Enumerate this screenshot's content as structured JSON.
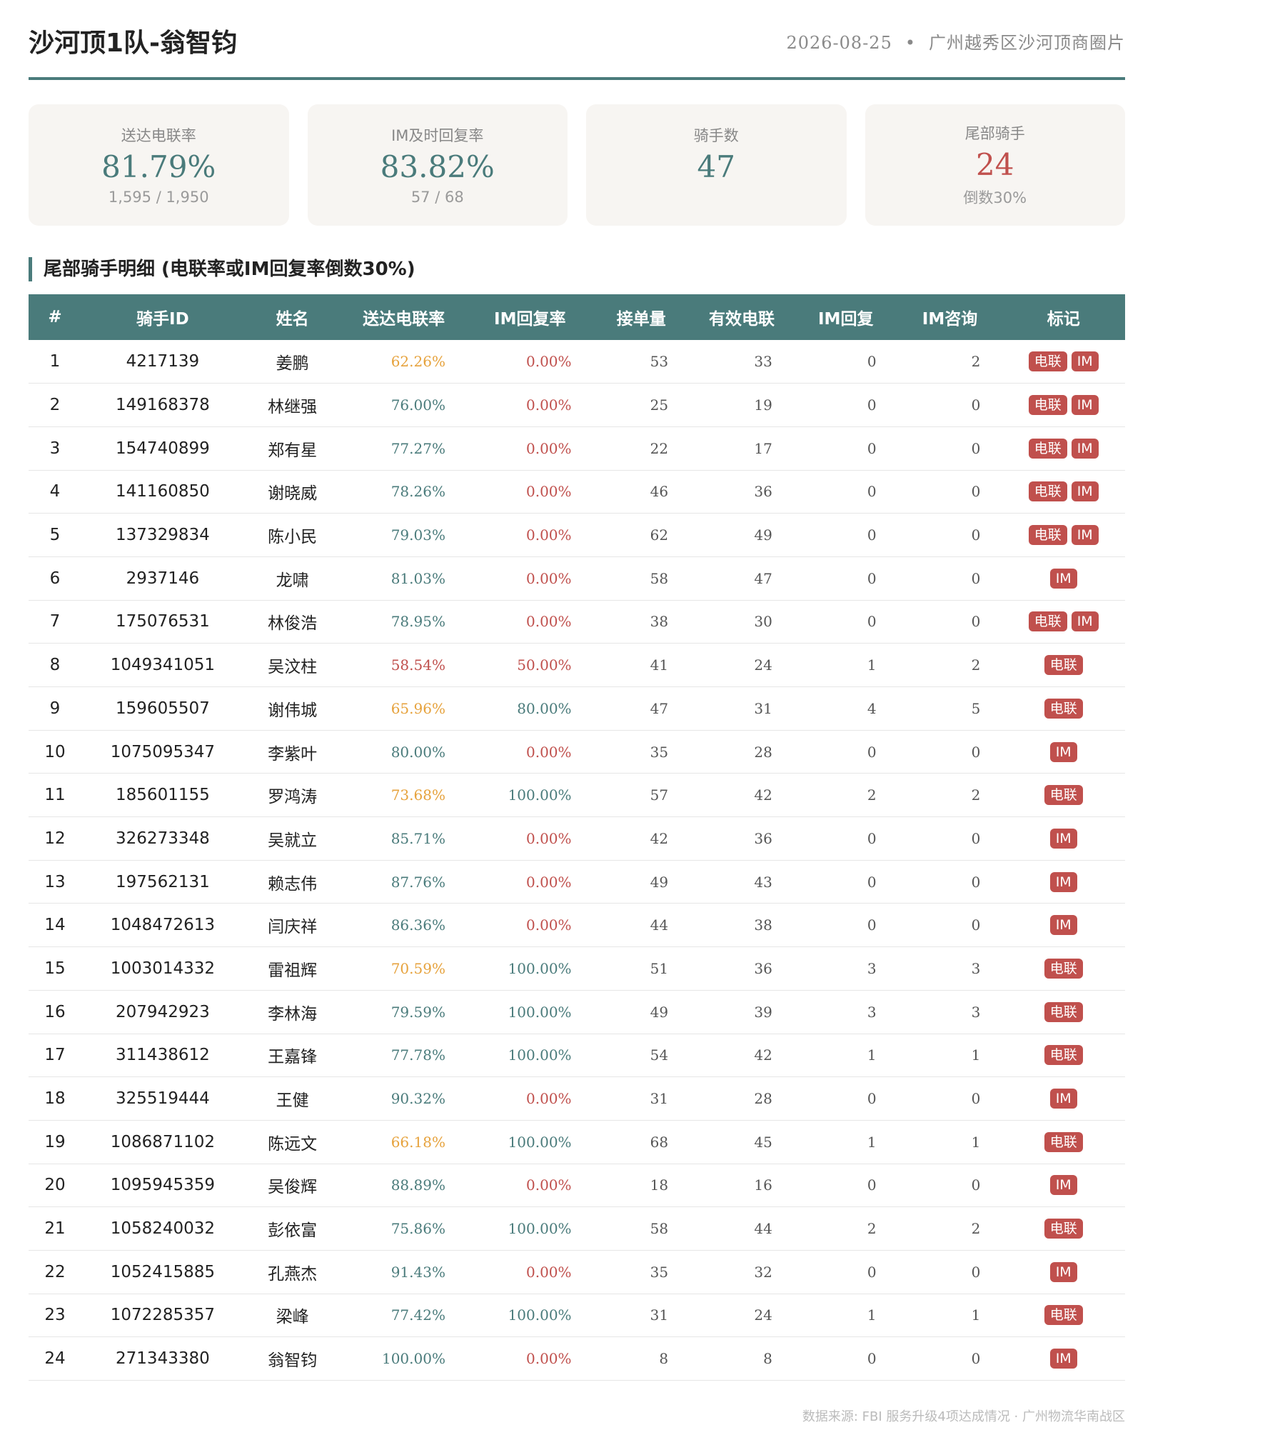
{
  "header": {
    "title": "沙河顶1队-翁智钧",
    "date": "2026-08-25",
    "separator": "•",
    "area": "广州越秀区沙河顶商圈片"
  },
  "cards": [
    {
      "label": "送达电联率",
      "value": "81.79%",
      "sub": "1,595 / 1,950",
      "accent": "#4a7b7b"
    },
    {
      "label": "IM及时回复率",
      "value": "83.82%",
      "sub": "57 / 68",
      "accent": "#4a7b7b"
    },
    {
      "label": "骑手数",
      "value": "47",
      "sub": "",
      "accent": "#4a7b7b"
    },
    {
      "label": "尾部骑手",
      "value": "24",
      "sub": "倒数30%",
      "accent": "#c0504d"
    }
  ],
  "section_title": "尾部骑手明细 (电联率或IM回复率倒数30%)",
  "table": {
    "headers": [
      "#",
      "骑手ID",
      "姓名",
      "送达电联率",
      "IM回复率",
      "接单量",
      "有效电联",
      "IM回复",
      "IM咨询",
      "标记"
    ],
    "rows": [
      {
        "idx": "1",
        "id": "4217139",
        "name": "姜鹏",
        "rate": "62.26%",
        "rate_level": "orange",
        "im": "0.00%",
        "im_level": "red",
        "orders": "53",
        "calls": "33",
        "im_reply": "0",
        "im_ask": "2",
        "tags": [
          "电联",
          "IM"
        ]
      },
      {
        "idx": "2",
        "id": "149168378",
        "name": "林继强",
        "rate": "76.00%",
        "rate_level": "teal",
        "im": "0.00%",
        "im_level": "red",
        "orders": "25",
        "calls": "19",
        "im_reply": "0",
        "im_ask": "0",
        "tags": [
          "电联",
          "IM"
        ]
      },
      {
        "idx": "3",
        "id": "154740899",
        "name": "郑有星",
        "rate": "77.27%",
        "rate_level": "teal",
        "im": "0.00%",
        "im_level": "red",
        "orders": "22",
        "calls": "17",
        "im_reply": "0",
        "im_ask": "0",
        "tags": [
          "电联",
          "IM"
        ]
      },
      {
        "idx": "4",
        "id": "141160850",
        "name": "谢晓威",
        "rate": "78.26%",
        "rate_level": "teal",
        "im": "0.00%",
        "im_level": "red",
        "orders": "46",
        "calls": "36",
        "im_reply": "0",
        "im_ask": "0",
        "tags": [
          "电联",
          "IM"
        ]
      },
      {
        "idx": "5",
        "id": "137329834",
        "name": "陈小民",
        "rate": "79.03%",
        "rate_level": "teal",
        "im": "0.00%",
        "im_level": "red",
        "orders": "62",
        "calls": "49",
        "im_reply": "0",
        "im_ask": "0",
        "tags": [
          "电联",
          "IM"
        ]
      },
      {
        "idx": "6",
        "id": "2937146",
        "name": "龙啸",
        "rate": "81.03%",
        "rate_level": "teal",
        "im": "0.00%",
        "im_level": "red",
        "orders": "58",
        "calls": "47",
        "im_reply": "0",
        "im_ask": "0",
        "tags": [
          "IM"
        ]
      },
      {
        "idx": "7",
        "id": "175076531",
        "name": "林俊浩",
        "rate": "78.95%",
        "rate_level": "teal",
        "im": "0.00%",
        "im_level": "red",
        "orders": "38",
        "calls": "30",
        "im_reply": "0",
        "im_ask": "0",
        "tags": [
          "电联",
          "IM"
        ]
      },
      {
        "idx": "8",
        "id": "1049341051",
        "name": "吴汶柱",
        "rate": "58.54%",
        "rate_level": "red",
        "im": "50.00%",
        "im_level": "red",
        "orders": "41",
        "calls": "24",
        "im_reply": "1",
        "im_ask": "2",
        "tags": [
          "电联"
        ]
      },
      {
        "idx": "9",
        "id": "159605507",
        "name": "谢伟城",
        "rate": "65.96%",
        "rate_level": "orange",
        "im": "80.00%",
        "im_level": "teal",
        "orders": "47",
        "calls": "31",
        "im_reply": "4",
        "im_ask": "5",
        "tags": [
          "电联"
        ]
      },
      {
        "idx": "10",
        "id": "1075095347",
        "name": "李紫叶",
        "rate": "80.00%",
        "rate_level": "teal",
        "im": "0.00%",
        "im_level": "red",
        "orders": "35",
        "calls": "28",
        "im_reply": "0",
        "im_ask": "0",
        "tags": [
          "IM"
        ]
      },
      {
        "idx": "11",
        "id": "185601155",
        "name": "罗鸿涛",
        "rate": "73.68%",
        "rate_level": "orange",
        "im": "100.00%",
        "im_level": "teal",
        "orders": "57",
        "calls": "42",
        "im_reply": "2",
        "im_ask": "2",
        "tags": [
          "电联"
        ]
      },
      {
        "idx": "12",
        "id": "326273348",
        "name": "吴就立",
        "rate": "85.71%",
        "rate_level": "teal",
        "im": "0.00%",
        "im_level": "red",
        "orders": "42",
        "calls": "36",
        "im_reply": "0",
        "im_ask": "0",
        "tags": [
          "IM"
        ]
      },
      {
        "idx": "13",
        "id": "197562131",
        "name": "赖志伟",
        "rate": "87.76%",
        "rate_level": "teal",
        "im": "0.00%",
        "im_level": "red",
        "orders": "49",
        "calls": "43",
        "im_reply": "0",
        "im_ask": "0",
        "tags": [
          "IM"
        ]
      },
      {
        "idx": "14",
        "id": "1048472613",
        "name": "闫庆祥",
        "rate": "86.36%",
        "rate_level": "teal",
        "im": "0.00%",
        "im_level": "red",
        "orders": "44",
        "calls": "38",
        "im_reply": "0",
        "im_ask": "0",
        "tags": [
          "IM"
        ]
      },
      {
        "idx": "15",
        "id": "1003014332",
        "name": "雷祖辉",
        "rate": "70.59%",
        "rate_level": "orange",
        "im": "100.00%",
        "im_level": "teal",
        "orders": "51",
        "calls": "36",
        "im_reply": "3",
        "im_ask": "3",
        "tags": [
          "电联"
        ]
      },
      {
        "idx": "16",
        "id": "207942923",
        "name": "李林海",
        "rate": "79.59%",
        "rate_level": "teal",
        "im": "100.00%",
        "im_level": "teal",
        "orders": "49",
        "calls": "39",
        "im_reply": "3",
        "im_ask": "3",
        "tags": [
          "电联"
        ]
      },
      {
        "idx": "17",
        "id": "311438612",
        "name": "王嘉锋",
        "rate": "77.78%",
        "rate_level": "teal",
        "im": "100.00%",
        "im_level": "teal",
        "orders": "54",
        "calls": "42",
        "im_reply": "1",
        "im_ask": "1",
        "tags": [
          "电联"
        ]
      },
      {
        "idx": "18",
        "id": "325519444",
        "name": "王健",
        "rate": "90.32%",
        "rate_level": "teal",
        "im": "0.00%",
        "im_level": "red",
        "orders": "31",
        "calls": "28",
        "im_reply": "0",
        "im_ask": "0",
        "tags": [
          "IM"
        ]
      },
      {
        "idx": "19",
        "id": "1086871102",
        "name": "陈远文",
        "rate": "66.18%",
        "rate_level": "orange",
        "im": "100.00%",
        "im_level": "teal",
        "orders": "68",
        "calls": "45",
        "im_reply": "1",
        "im_ask": "1",
        "tags": [
          "电联"
        ]
      },
      {
        "idx": "20",
        "id": "1095945359",
        "name": "吴俊辉",
        "rate": "88.89%",
        "rate_level": "teal",
        "im": "0.00%",
        "im_level": "red",
        "orders": "18",
        "calls": "16",
        "im_reply": "0",
        "im_ask": "0",
        "tags": [
          "IM"
        ]
      },
      {
        "idx": "21",
        "id": "1058240032",
        "name": "彭依富",
        "rate": "75.86%",
        "rate_level": "teal",
        "im": "100.00%",
        "im_level": "teal",
        "orders": "58",
        "calls": "44",
        "im_reply": "2",
        "im_ask": "2",
        "tags": [
          "电联"
        ]
      },
      {
        "idx": "22",
        "id": "1052415885",
        "name": "孔燕杰",
        "rate": "91.43%",
        "rate_level": "teal",
        "im": "0.00%",
        "im_level": "red",
        "orders": "35",
        "calls": "32",
        "im_reply": "0",
        "im_ask": "0",
        "tags": [
          "IM"
        ]
      },
      {
        "idx": "23",
        "id": "1072285357",
        "name": "梁峰",
        "rate": "77.42%",
        "rate_level": "teal",
        "im": "100.00%",
        "im_level": "teal",
        "orders": "31",
        "calls": "24",
        "im_reply": "1",
        "im_ask": "1",
        "tags": [
          "电联"
        ]
      },
      {
        "idx": "24",
        "id": "271343380",
        "name": "翁智钧",
        "rate": "100.00%",
        "rate_level": "teal",
        "im": "0.00%",
        "im_level": "red",
        "orders": "8",
        "calls": "8",
        "im_reply": "0",
        "im_ask": "0",
        "tags": [
          "IM"
        ]
      }
    ]
  },
  "footer": "数据来源: FBI 服务升级4项达成情况 · 广州物流华南战区",
  "colors": {
    "accent": "#4a7b7b",
    "alert": "#c0504d",
    "warn": "#e6a23c"
  }
}
